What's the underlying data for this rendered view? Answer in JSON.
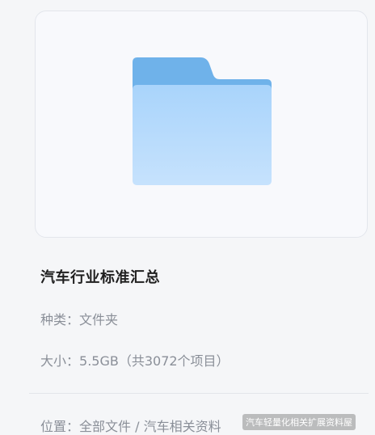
{
  "file": {
    "name": "汽车行业标准汇总",
    "kind_label": "种类：",
    "kind_value": "文件夹",
    "size_label": "大小：",
    "size_value": "5.5GB（共3072个项目）",
    "location_label": "位置：",
    "location_value": "全部文件 / 汽车相关资料"
  },
  "icons": {
    "preview": "folder-icon"
  },
  "watermark": "汽车轻量化相关扩展资料屋",
  "colors": {
    "folder_back": "#6fb2ea",
    "folder_front_top": "#a9d4fb",
    "folder_front_bottom": "#c6e2fd"
  }
}
